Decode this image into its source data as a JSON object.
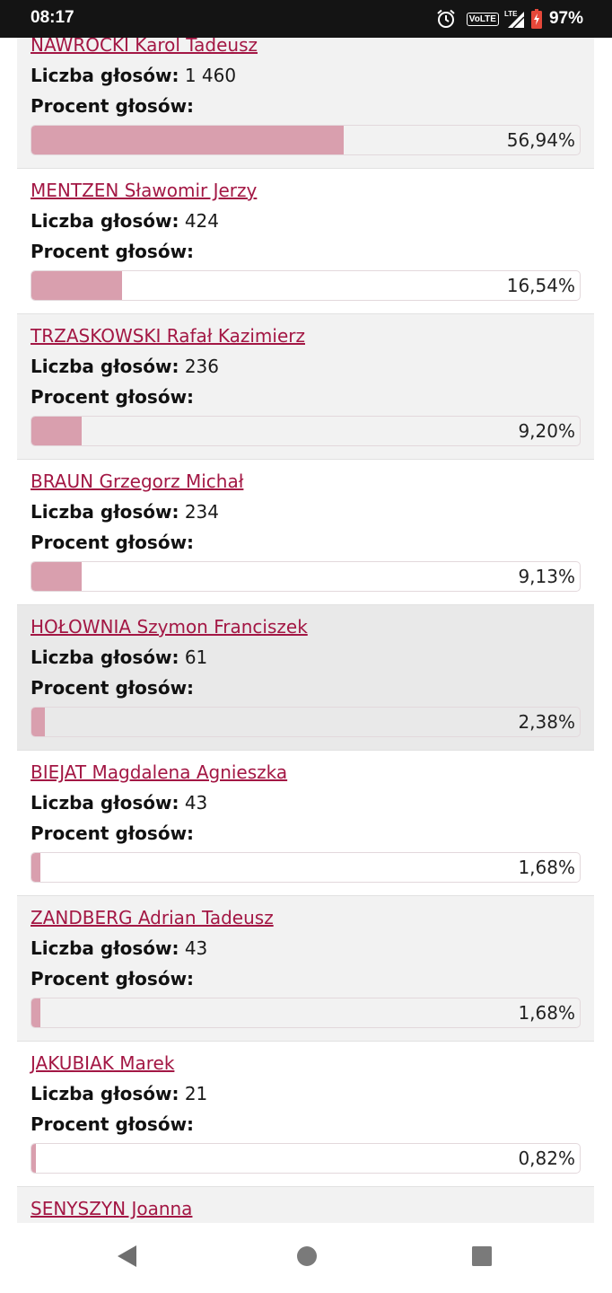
{
  "status_bar": {
    "time": "08:17",
    "network": "VoLTE",
    "battery": "97%"
  },
  "labels": {
    "votes": "Liczba głosów:",
    "percent": "Procent głosów:"
  },
  "candidates": [
    {
      "name": "NAWROCKI Karol Tadeusz",
      "votes": "1 460",
      "percent_text": "56,94%",
      "percent": 56.94
    },
    {
      "name": "MENTZEN Sławomir Jerzy",
      "votes": "424",
      "percent_text": "16,54%",
      "percent": 16.54
    },
    {
      "name": "TRZASKOWSKI Rafał Kazimierz",
      "votes": "236",
      "percent_text": "9,20%",
      "percent": 9.2
    },
    {
      "name": "BRAUN Grzegorz Michał",
      "votes": "234",
      "percent_text": "9,13%",
      "percent": 9.13
    },
    {
      "name": "HOŁOWNIA Szymon Franciszek",
      "votes": "61",
      "percent_text": "2,38%",
      "percent": 2.38
    },
    {
      "name": "BIEJAT Magdalena Agnieszka",
      "votes": "43",
      "percent_text": "1,68%",
      "percent": 1.68
    },
    {
      "name": "ZANDBERG Adrian Tadeusz",
      "votes": "43",
      "percent_text": "1,68%",
      "percent": 1.68
    },
    {
      "name": "JAKUBIAK Marek",
      "votes": "21",
      "percent_text": "0,82%",
      "percent": 0.82
    },
    {
      "name": "SENYSZYN Joanna",
      "votes": "",
      "percent_text": "",
      "percent": null
    }
  ],
  "colors": {
    "link": "#a31744",
    "bar_fill": "#d99fae",
    "row_shade": "#f2f2f2",
    "status_bar": "#141414"
  },
  "icons": {
    "alarm": "alarm-icon",
    "signal": "signal-icon",
    "battery": "battery-icon",
    "back": "back-triangle-icon",
    "home": "home-circle-icon",
    "recents": "recents-square-icon"
  }
}
